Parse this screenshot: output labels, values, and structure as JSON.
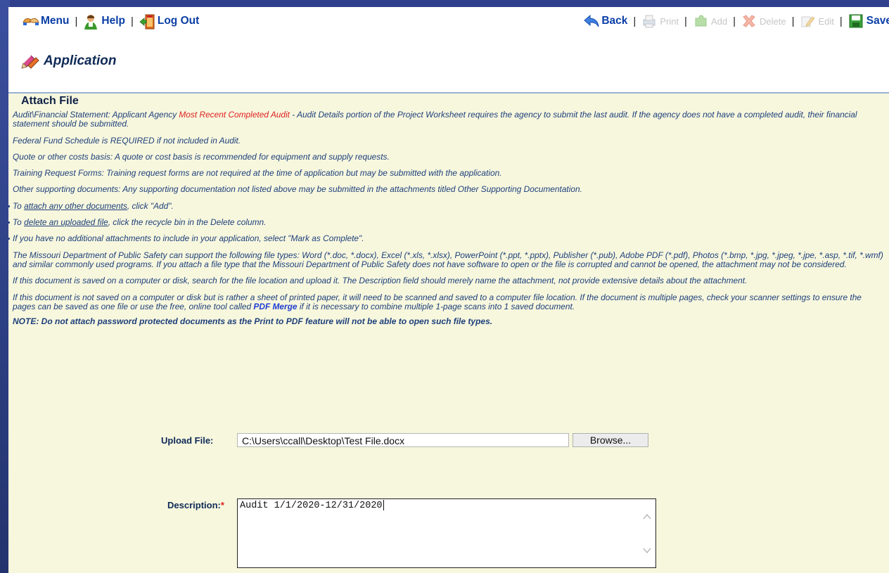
{
  "toolbar": {
    "menu_label": "Menu",
    "help_label": "Help",
    "logout_label": "Log Out",
    "back_label": "Back",
    "print_label": "Print",
    "add_label": "Add",
    "delete_label": "Delete",
    "edit_label": "Edit",
    "save_label": "Save",
    "separator": "|"
  },
  "page": {
    "title": "Application"
  },
  "panel": {
    "title": "Attach File",
    "audit_prefix": "Audit\\Financial Statement: Applicant Agency ",
    "audit_highlight": "Most Recent Completed Audit",
    "audit_suffix": " - Audit Details portion of the Project Worksheet requires the agency to submit the last audit. If the agency does not have a completed audit, their financial statement should be submitted.",
    "federal_fund": "Federal Fund Schedule is REQUIRED if not included in Audit.",
    "quote": "Quote or other costs basis: A quote or cost basis is recommended for equipment and supply requests.",
    "training": "Training Request Forms: Training request forms are not required at the time of application but may be submitted with the application.",
    "other_docs": "Other supporting documents: Any supporting documentation not listed above may be submitted in the attachments titled Other Supporting Documentation.",
    "bullet_add_prefix": "To ",
    "bullet_add_link": "attach any other documents",
    "bullet_add_suffix": ", click \"Add\".",
    "bullet_delete_prefix": "To ",
    "bullet_delete_link": "delete an uploaded file",
    "bullet_delete_suffix": ", click the recycle bin in the Delete column.",
    "bullet_complete": "If you have no additional attachments to include in your application, select \"Mark as Complete\".",
    "file_types": "The Missouri Department of Public Safety can support the following file types: Word (*.doc, *.docx), Excel (*.xls, *.xlsx), PowerPoint (*.ppt, *.pptx), Publisher (*.pub), Adobe PDF (*.pdf), Photos (*.bmp, *.jpg, *.jpeg, *.jpe, *.asp, *.tif, *.wmf) and similar commonly used programs. If you attach a file type that the Missouri Department of Public Safety does not have software to open or the file is corrupted and cannot be opened, the attachment may not be considered.",
    "saved_doc": "If this document is saved on a computer or disk, search for the file location and upload it. The Description field should merely name the attachment, not provide extensive details about the attachment.",
    "scan_prefix": "If this document is not saved on a computer or disk but is rather a sheet of printed paper, it will need to be scanned and saved to a computer file location. If the document is multiple pages, check your scanner settings to ensure the pages can be saved as one file or use the free, online tool called ",
    "scan_link": "PDF Merge",
    "scan_suffix": " if it is necessary to combine multiple 1-page scans into 1 saved document.",
    "note": "NOTE: Do not attach password protected documents as the Print to PDF feature will not be able to open such file types."
  },
  "form": {
    "upload_label": "Upload File:",
    "upload_value": "C:\\Users\\ccall\\Desktop\\Test File.docx",
    "browse_label": "Browse...",
    "description_label": "Description:",
    "required_marker": "*",
    "description_value": "Audit 1/1/2020-12/31/2020"
  },
  "colors": {
    "link_blue": "#0a3ea6",
    "panel_bg": "#f7f7de",
    "required_red": "#e02020"
  }
}
